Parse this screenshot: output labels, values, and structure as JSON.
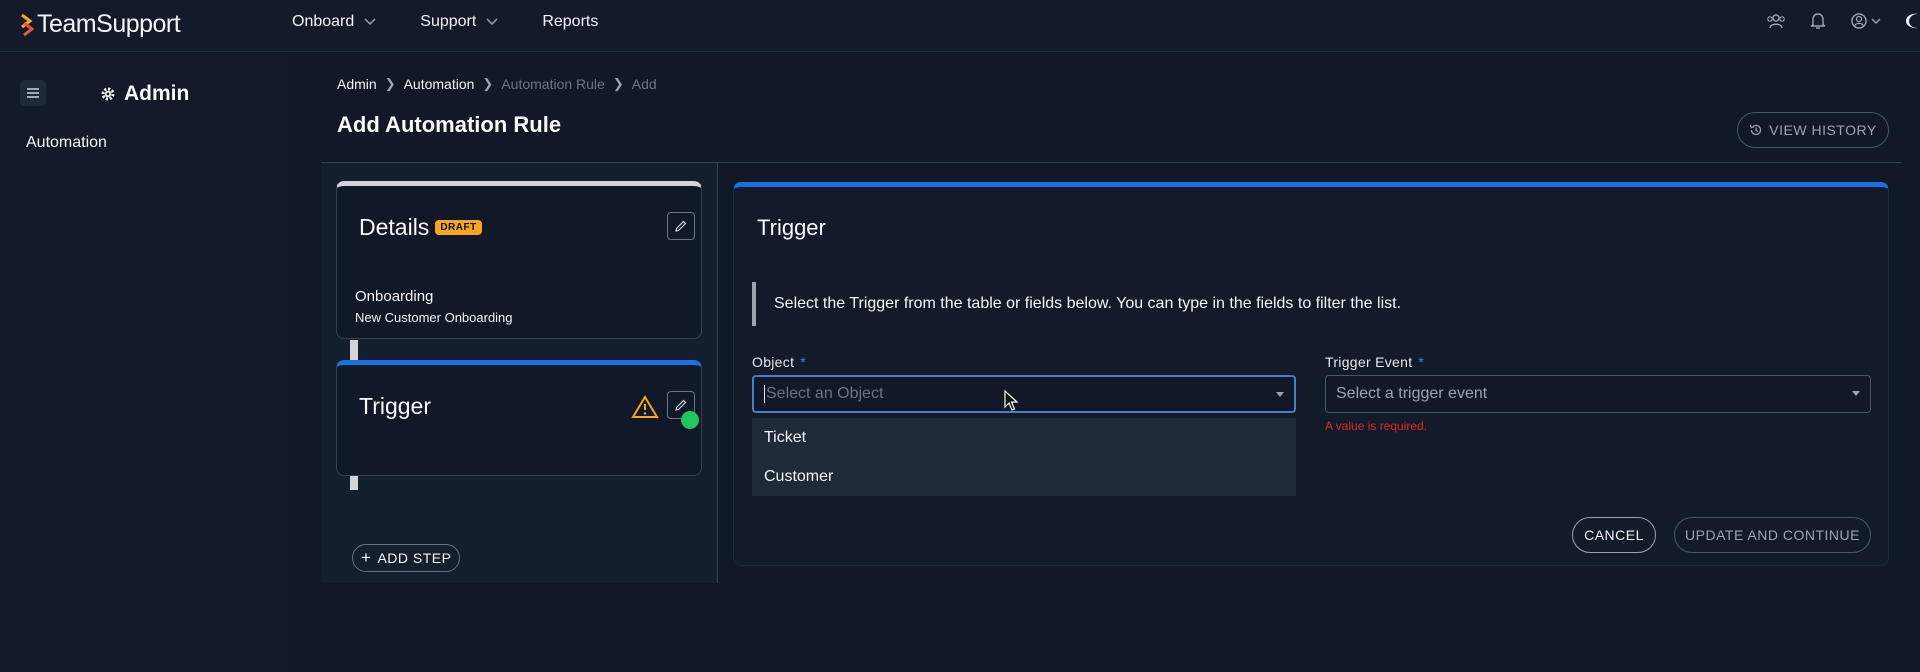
{
  "brand": {
    "name_a": "Team",
    "name_b": "Support"
  },
  "nav": {
    "items": [
      "Onboard",
      "Support",
      "Reports"
    ]
  },
  "sidebar": {
    "title": "Admin",
    "items": [
      "Automation"
    ]
  },
  "breadcrumb": {
    "items": [
      "Admin",
      "Automation",
      "Automation Rule",
      "Add"
    ]
  },
  "page": {
    "title": "Add Automation Rule",
    "view_history": "VIEW HISTORY"
  },
  "details_card": {
    "title": "Details",
    "badge": "DRAFT",
    "line1": "Onboarding",
    "line2": "New Customer Onboarding"
  },
  "trigger_card": {
    "title": "Trigger"
  },
  "add_step": "ADD STEP",
  "trigger_panel": {
    "title": "Trigger",
    "info": "Select the Trigger from the table or fields below. You can type in the fields to filter the list.",
    "object_label": "Object",
    "object_placeholder": "Select an Object",
    "object_options": [
      "Ticket",
      "Customer"
    ],
    "event_label": "Trigger Event",
    "event_placeholder": "Select a trigger event",
    "required_marker": "*",
    "error": "A value is required.",
    "cancel": "CANCEL",
    "update": "UPDATE AND CONTINUE"
  }
}
